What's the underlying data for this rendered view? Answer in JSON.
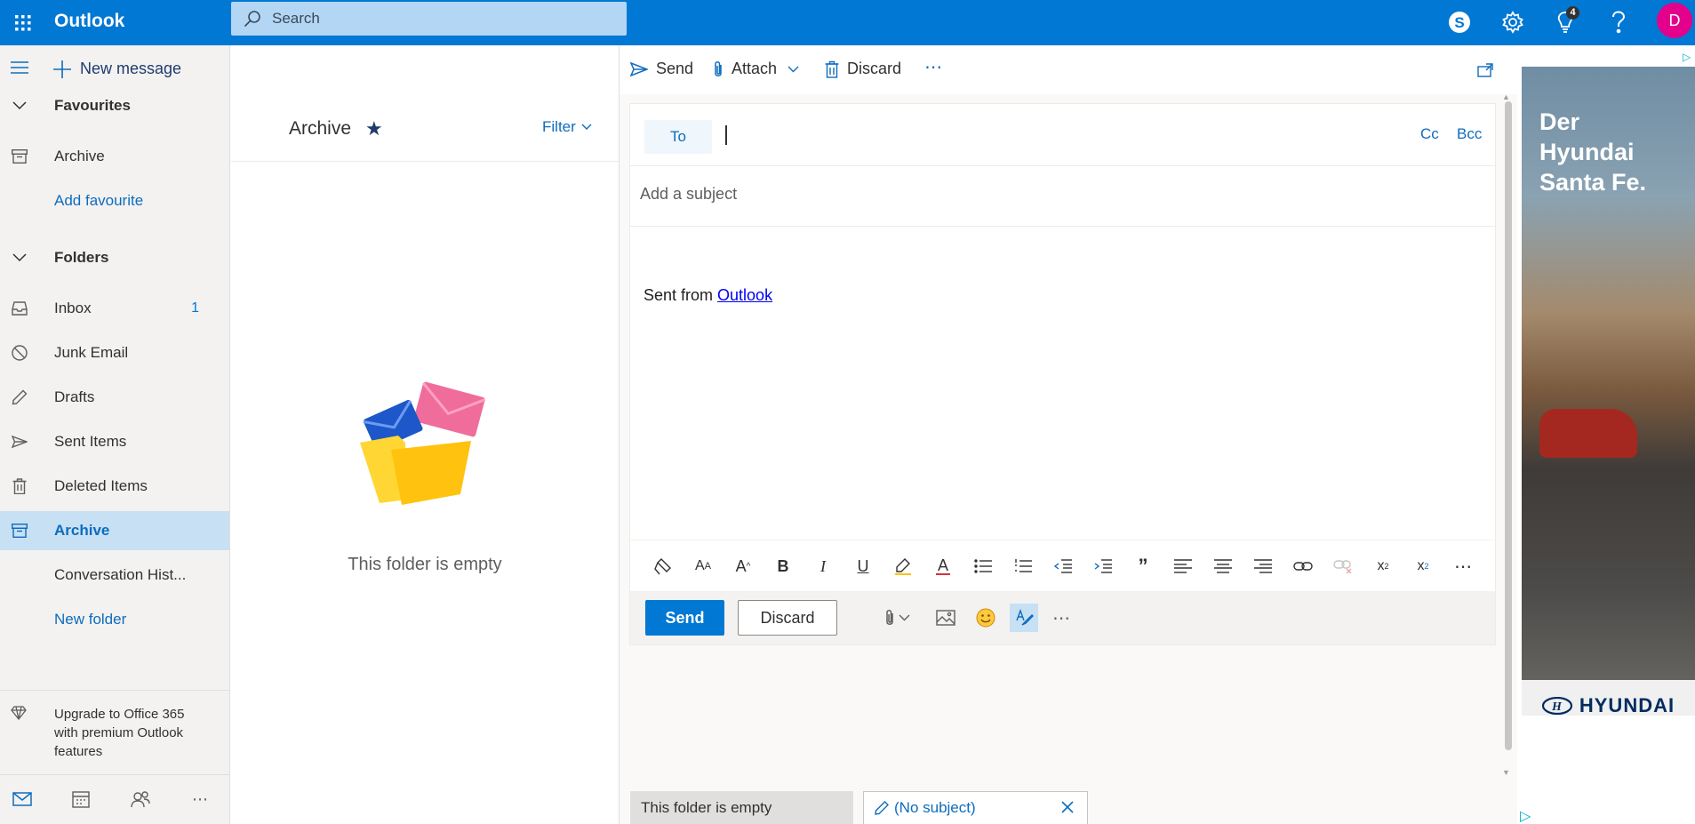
{
  "app": {
    "brand": "Outlook",
    "avatar_initial": "D",
    "notification_count": "4"
  },
  "search": {
    "placeholder": "Search"
  },
  "colors": {
    "accent": "#0078d4",
    "avatar": "#e3008c",
    "selected_bg": "#c7e0f4"
  },
  "leftnav": {
    "new_message": "New message",
    "favourites_header": "Favourites",
    "favourites": [
      {
        "label": "Archive",
        "icon": "archive-icon"
      }
    ],
    "add_favourite": "Add favourite",
    "folders_header": "Folders",
    "folders": [
      {
        "label": "Inbox",
        "icon": "inbox-icon",
        "count": "1"
      },
      {
        "label": "Junk Email",
        "icon": "block-icon"
      },
      {
        "label": "Drafts",
        "icon": "pencil-icon"
      },
      {
        "label": "Sent Items",
        "icon": "send-icon"
      },
      {
        "label": "Deleted Items",
        "icon": "trash-icon"
      },
      {
        "label": "Archive",
        "icon": "archive-icon",
        "selected": true
      },
      {
        "label": "Conversation Hist..."
      }
    ],
    "new_folder": "New folder",
    "upgrade": "Upgrade to Office 365 with premium Outlook features"
  },
  "message_list": {
    "title": "Archive",
    "filter": "Filter",
    "empty_text": "This folder is empty"
  },
  "command_bar": {
    "send": "Send",
    "attach": "Attach",
    "discard": "Discard"
  },
  "compose": {
    "to_label": "To",
    "cc": "Cc",
    "bcc": "Bcc",
    "subject_placeholder": "Add a subject",
    "body_prefix": "Sent from ",
    "body_link": "Outlook",
    "send_button": "Send",
    "discard_button": "Discard"
  },
  "bottom_tabs": [
    "This folder is empty",
    "(No subject)"
  ],
  "ad": {
    "headline_line1": "Der",
    "headline_line2": "Hyundai",
    "headline_line3": "Santa Fe.",
    "brand": "HYUNDAI"
  }
}
